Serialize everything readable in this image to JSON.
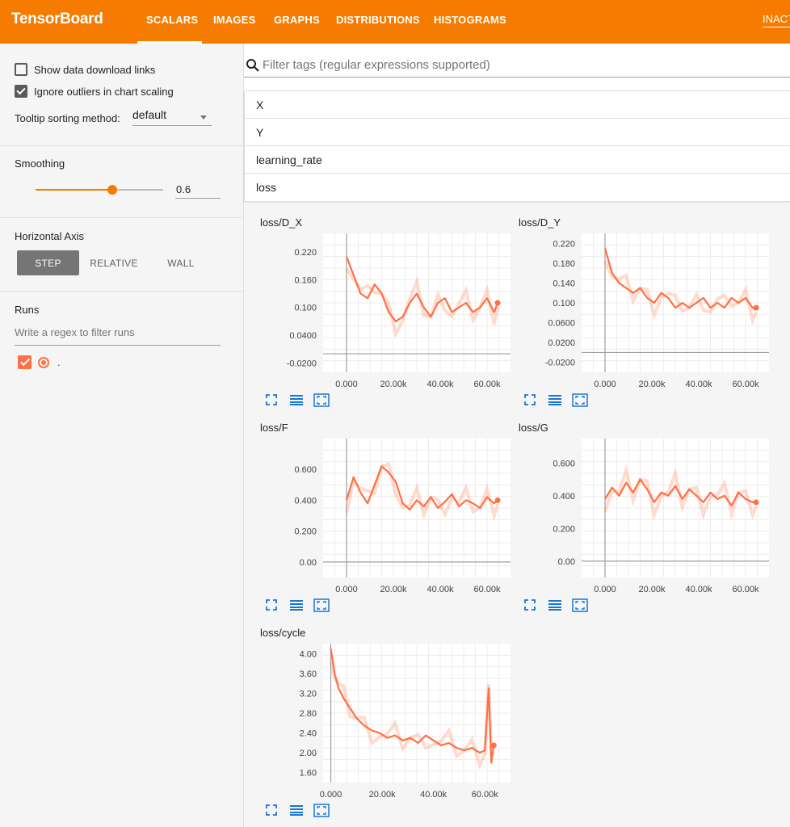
{
  "app": {
    "brand": "TensorBoard",
    "tabs": [
      "SCALARS",
      "IMAGES",
      "GRAPHS",
      "DISTRIBUTIONS",
      "HISTOGRAMS"
    ],
    "active_tab": "SCALARS",
    "inactive_label": "INACT",
    "accent_color": "#f57c00",
    "series_color": "#ff7043"
  },
  "sidebar": {
    "show_download_links": {
      "label": "Show data download links",
      "checked": false
    },
    "ignore_outliers": {
      "label": "Ignore outliers in chart scaling",
      "checked": true
    },
    "tooltip_sorting": {
      "label": "Tooltip sorting method:",
      "value": "default"
    },
    "smoothing": {
      "title": "Smoothing",
      "value": "0.6",
      "fraction": 0.6
    },
    "horizontal_axis": {
      "title": "Horizontal Axis",
      "options": [
        "STEP",
        "RELATIVE",
        "WALL"
      ],
      "selected": "STEP"
    },
    "runs": {
      "title": "Runs",
      "filter_placeholder": "Write a regex to filter runs",
      "items": [
        {
          "label": ".",
          "checked": true
        }
      ]
    }
  },
  "main": {
    "filter_placeholder": "Filter tags (regular expressions supported)",
    "tag_groups": [
      "X",
      "Y",
      "learning_rate",
      "loss"
    ]
  },
  "chart_data": [
    {
      "title": "loss/D_X",
      "type": "line",
      "xticks": [
        "0.000",
        "20.00k",
        "40.00k",
        "60.00k"
      ],
      "yticks": [
        "0.220",
        "0.160",
        "0.100",
        "0.0400",
        "-0.0200"
      ],
      "xlim": [
        -10000,
        70000
      ],
      "ylim": [
        -0.04,
        0.26
      ],
      "x": [
        0,
        3000,
        6000,
        9000,
        12000,
        15000,
        18000,
        21000,
        24000,
        27000,
        30000,
        33000,
        36000,
        39000,
        42000,
        45000,
        48000,
        51000,
        54000,
        57000,
        60000,
        63000,
        64500
      ],
      "y": [
        0.21,
        0.17,
        0.13,
        0.12,
        0.15,
        0.13,
        0.09,
        0.07,
        0.08,
        0.11,
        0.13,
        0.1,
        0.08,
        0.11,
        0.12,
        0.09,
        0.1,
        0.11,
        0.09,
        0.1,
        0.12,
        0.09,
        0.11
      ]
    },
    {
      "title": "loss/D_Y",
      "type": "line",
      "xticks": [
        "0.000",
        "20.00k",
        "40.00k",
        "60.00k"
      ],
      "yticks": [
        "0.220",
        "0.180",
        "0.140",
        "0.100",
        "0.0600",
        "0.0200",
        "-0.0200"
      ],
      "xlim": [
        -10000,
        70000
      ],
      "ylim": [
        -0.04,
        0.24
      ],
      "x": [
        0,
        3000,
        6000,
        9000,
        12000,
        15000,
        18000,
        21000,
        24000,
        27000,
        30000,
        33000,
        36000,
        39000,
        42000,
        45000,
        48000,
        51000,
        54000,
        57000,
        60000,
        63000,
        64500
      ],
      "y": [
        0.21,
        0.16,
        0.14,
        0.13,
        0.12,
        0.13,
        0.11,
        0.1,
        0.12,
        0.11,
        0.09,
        0.1,
        0.09,
        0.1,
        0.11,
        0.09,
        0.1,
        0.09,
        0.11,
        0.1,
        0.11,
        0.09,
        0.09
      ]
    },
    {
      "title": "loss/F",
      "type": "line",
      "xticks": [
        "0.000",
        "20.00k",
        "40.00k",
        "60.00k"
      ],
      "yticks": [
        "0.600",
        "0.400",
        "0.200",
        "0.00"
      ],
      "xlim": [
        -10000,
        70000
      ],
      "ylim": [
        -0.1,
        0.8
      ],
      "x": [
        0,
        3000,
        6000,
        9000,
        12000,
        15000,
        18000,
        21000,
        24000,
        27000,
        30000,
        33000,
        36000,
        39000,
        42000,
        45000,
        48000,
        51000,
        54000,
        57000,
        60000,
        63000,
        64500
      ],
      "y": [
        0.4,
        0.55,
        0.45,
        0.38,
        0.5,
        0.62,
        0.58,
        0.52,
        0.38,
        0.34,
        0.4,
        0.36,
        0.42,
        0.35,
        0.39,
        0.44,
        0.36,
        0.4,
        0.38,
        0.35,
        0.42,
        0.38,
        0.4
      ]
    },
    {
      "title": "loss/G",
      "type": "line",
      "xticks": [
        "0.000",
        "20.00k",
        "40.00k",
        "60.00k"
      ],
      "yticks": [
        "0.600",
        "0.400",
        "0.200",
        "0.00"
      ],
      "xlim": [
        -10000,
        70000
      ],
      "ylim": [
        -0.1,
        0.75
      ],
      "x": [
        0,
        3000,
        6000,
        9000,
        12000,
        15000,
        18000,
        21000,
        24000,
        27000,
        30000,
        33000,
        36000,
        39000,
        42000,
        45000,
        48000,
        51000,
        54000,
        57000,
        60000,
        63000,
        64500
      ],
      "y": [
        0.38,
        0.45,
        0.4,
        0.48,
        0.42,
        0.5,
        0.44,
        0.36,
        0.42,
        0.4,
        0.46,
        0.38,
        0.44,
        0.4,
        0.36,
        0.42,
        0.38,
        0.4,
        0.34,
        0.42,
        0.38,
        0.36,
        0.36
      ]
    },
    {
      "title": "loss/cycle",
      "type": "line",
      "xticks": [
        "0.000",
        "20.00k",
        "40.00k",
        "60.00k"
      ],
      "yticks": [
        "4.00",
        "3.60",
        "3.20",
        "2.80",
        "2.40",
        "2.00",
        "1.60"
      ],
      "xlim": [
        -3000,
        70000
      ],
      "ylim": [
        1.4,
        4.2
      ],
      "x": [
        0,
        1500,
        3000,
        5000,
        7500,
        10000,
        13000,
        16000,
        19000,
        22000,
        25000,
        28000,
        31000,
        34000,
        37000,
        40000,
        43000,
        46000,
        49000,
        52000,
        55000,
        58000,
        60000,
        61500,
        62500,
        63500
      ],
      "y": [
        4.1,
        3.6,
        3.3,
        3.1,
        2.9,
        2.7,
        2.55,
        2.45,
        2.4,
        2.3,
        2.35,
        2.25,
        2.3,
        2.2,
        2.35,
        2.25,
        2.15,
        2.2,
        2.1,
        2.05,
        2.1,
        2.0,
        2.05,
        3.3,
        1.8,
        2.15
      ]
    }
  ]
}
